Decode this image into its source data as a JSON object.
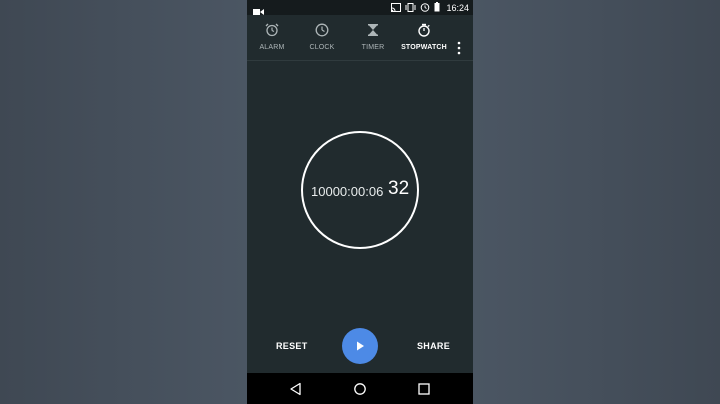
{
  "status_bar": {
    "time": "16:24",
    "icons": [
      "video-camera-icon",
      "cast-icon",
      "vibrate-icon",
      "alarm-icon",
      "battery-icon"
    ]
  },
  "tabs": [
    {
      "label": "ALARM",
      "icon": "alarm-clock-icon",
      "active": false
    },
    {
      "label": "CLOCK",
      "icon": "clock-icon",
      "active": false
    },
    {
      "label": "TIMER",
      "icon": "hourglass-icon",
      "active": false
    },
    {
      "label": "STOPWATCH",
      "icon": "stopwatch-icon",
      "active": true
    }
  ],
  "stopwatch": {
    "elapsed": "10000:00:06",
    "hundredths": "32"
  },
  "controls": {
    "reset_label": "RESET",
    "share_label": "SHARE",
    "play_icon": "play-icon"
  },
  "nav": [
    "back-icon",
    "home-icon",
    "recents-icon"
  ],
  "colors": {
    "accent": "#4d8ae6",
    "background": "#212b2e"
  }
}
